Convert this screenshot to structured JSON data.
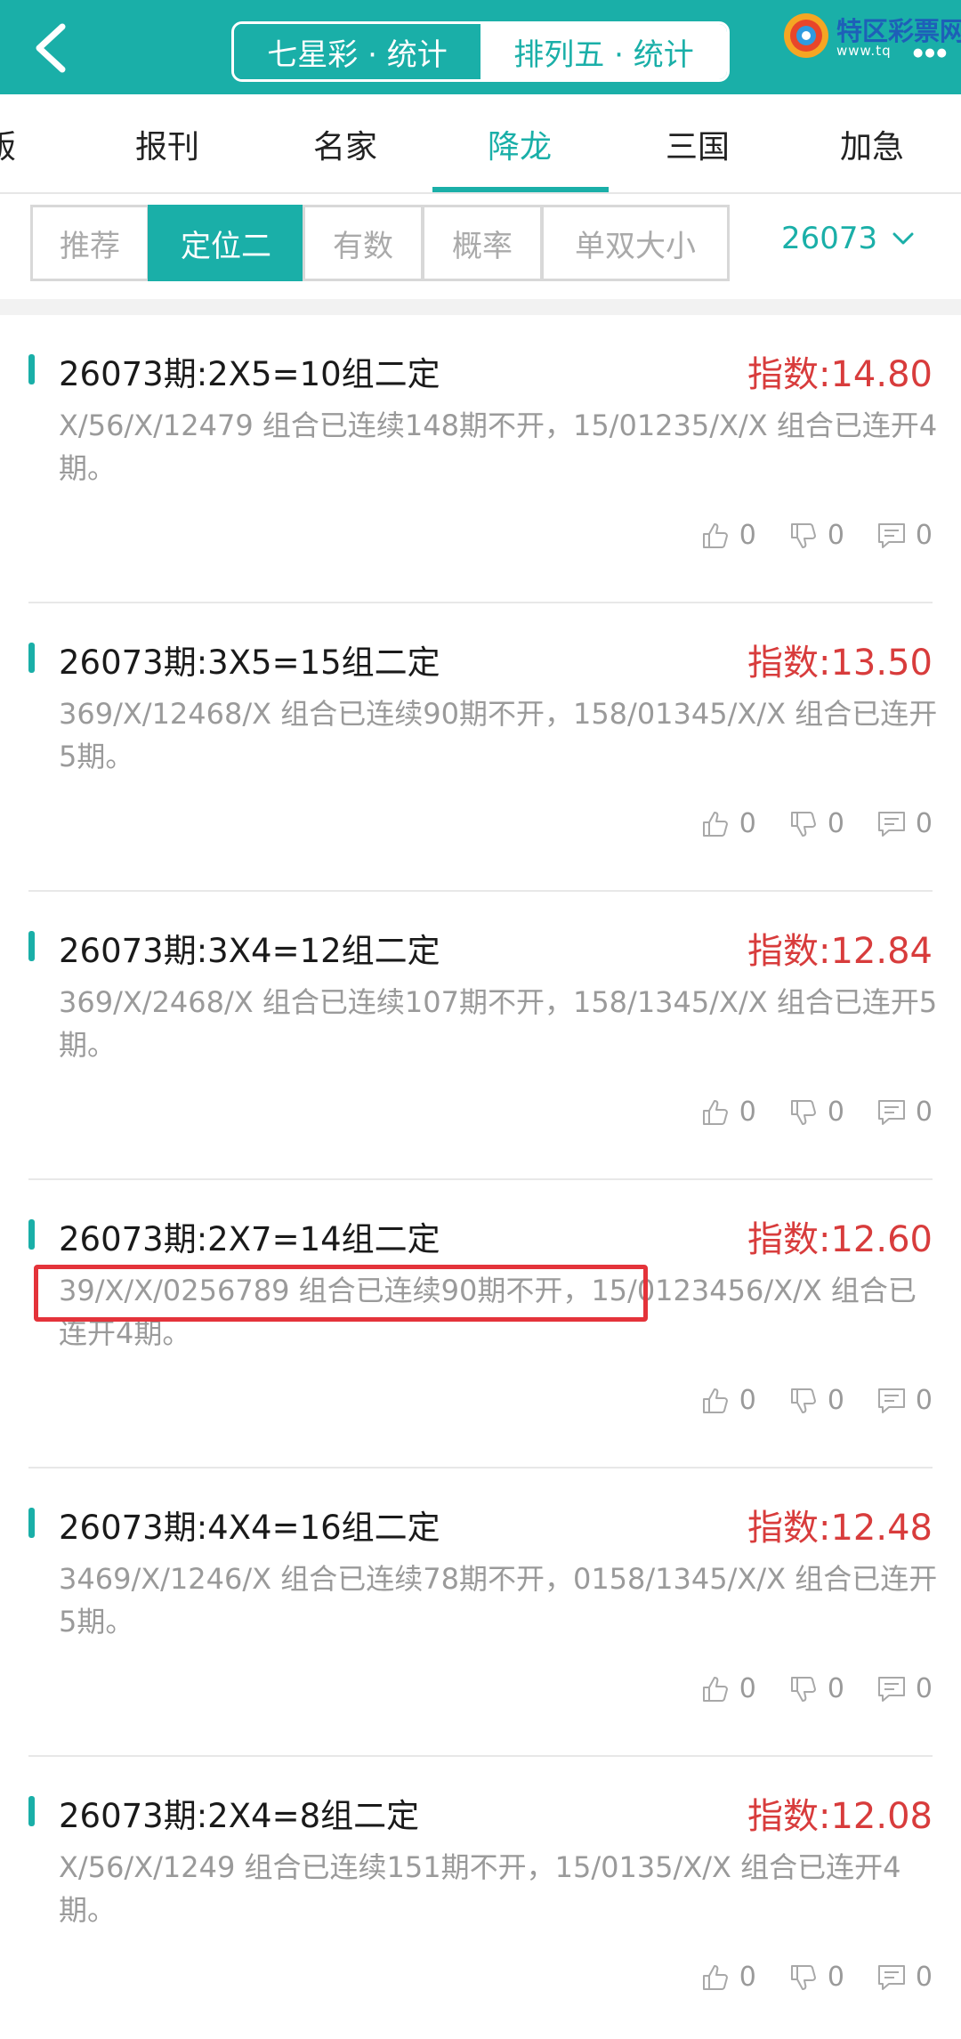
{
  "header": {
    "segments": [
      "七星彩 · 统计",
      "排列五 · 统计"
    ],
    "active_segment": 1,
    "logo_text": "特区彩票网",
    "logo_url": "www.tq",
    "logo_dots": "●●●"
  },
  "categories": [
    {
      "label": "版"
    },
    {
      "label": "报刊"
    },
    {
      "label": "名家"
    },
    {
      "label": "降龙"
    },
    {
      "label": "三国"
    },
    {
      "label": "加急"
    }
  ],
  "active_category": 3,
  "filters": [
    {
      "label": "推荐"
    },
    {
      "label": "定位二"
    },
    {
      "label": "有数"
    },
    {
      "label": "概率"
    },
    {
      "label": "单双大小"
    }
  ],
  "active_filter": 1,
  "period": "26073",
  "colors": {
    "accent": "#1aafa8",
    "index_red": "#d83c3c",
    "highlight": "#e4333a"
  },
  "items": [
    {
      "title": "26073期:2X5=10组二定",
      "index": "指数:14.80",
      "desc": "X/56/X/12479 组合已连续148期不开，15/01235/X/X 组合已连开4期。",
      "likes": "0",
      "dislikes": "0",
      "comments": "0"
    },
    {
      "title": "26073期:3X5=15组二定",
      "index": "指数:13.50",
      "desc": "369/X/12468/X 组合已连续90期不开，158/01345/X/X 组合已连开5期。",
      "likes": "0",
      "dislikes": "0",
      "comments": "0"
    },
    {
      "title": "26073期:3X4=12组二定",
      "index": "指数:12.84",
      "desc": "369/X/2468/X 组合已连续107期不开，158/1345/X/X 组合已连开5期。",
      "likes": "0",
      "dislikes": "0",
      "comments": "0"
    },
    {
      "title": "26073期:2X7=14组二定",
      "index": "指数:12.60",
      "desc": "39/X/X/0256789 组合已连续90期不开，15/0123456/X/X 组合已连开4期。",
      "likes": "0",
      "dislikes": "0",
      "comments": "0"
    },
    {
      "title": "26073期:4X4=16组二定",
      "index": "指数:12.48",
      "desc": "3469/X/1246/X 组合已连续78期不开，0158/1345/X/X 组合已连开5期。",
      "likes": "0",
      "dislikes": "0",
      "comments": "0"
    },
    {
      "title": "26073期:2X4=8组二定",
      "index": "指数:12.08",
      "desc": "X/56/X/1249 组合已连续151期不开，15/0135/X/X 组合已连开4期。",
      "likes": "0",
      "dislikes": "0",
      "comments": "0"
    }
  ]
}
